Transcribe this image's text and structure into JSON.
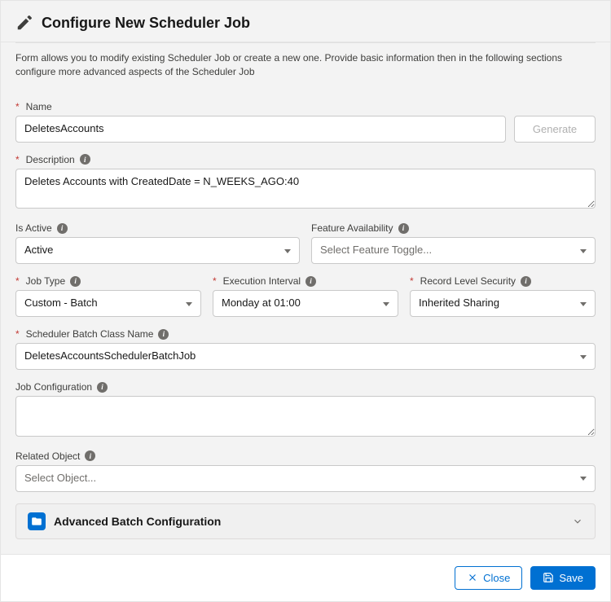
{
  "header": {
    "title": "Configure New Scheduler Job"
  },
  "intro": "Form allows you to modify existing Scheduler Job or create a new one. Provide basic information then in the following sections configure more advanced aspects of the Scheduler Job",
  "name": {
    "label": "Name",
    "value": "DeletesAccounts",
    "generate": "Generate"
  },
  "description": {
    "label": "Description",
    "value": "Deletes Accounts with CreatedDate = N_WEEKS_AGO:40"
  },
  "isActive": {
    "label": "Is Active",
    "value": "Active"
  },
  "featureAvailability": {
    "label": "Feature Availability",
    "placeholder": "Select Feature Toggle..."
  },
  "jobType": {
    "label": "Job Type",
    "value": "Custom - Batch"
  },
  "executionInterval": {
    "label": "Execution Interval",
    "value": "Monday at 01:00"
  },
  "recordLevelSecurity": {
    "label": "Record Level Security",
    "value": "Inherited Sharing"
  },
  "batchClass": {
    "label": "Scheduler Batch Class Name",
    "value": "DeletesAccountsSchedulerBatchJob"
  },
  "jobConfiguration": {
    "label": "Job Configuration",
    "value": ""
  },
  "relatedObject": {
    "label": "Related Object",
    "placeholder": "Select Object..."
  },
  "accordion": {
    "title": "Advanced Batch Configuration"
  },
  "footer": {
    "close": "Close",
    "save": "Save"
  }
}
